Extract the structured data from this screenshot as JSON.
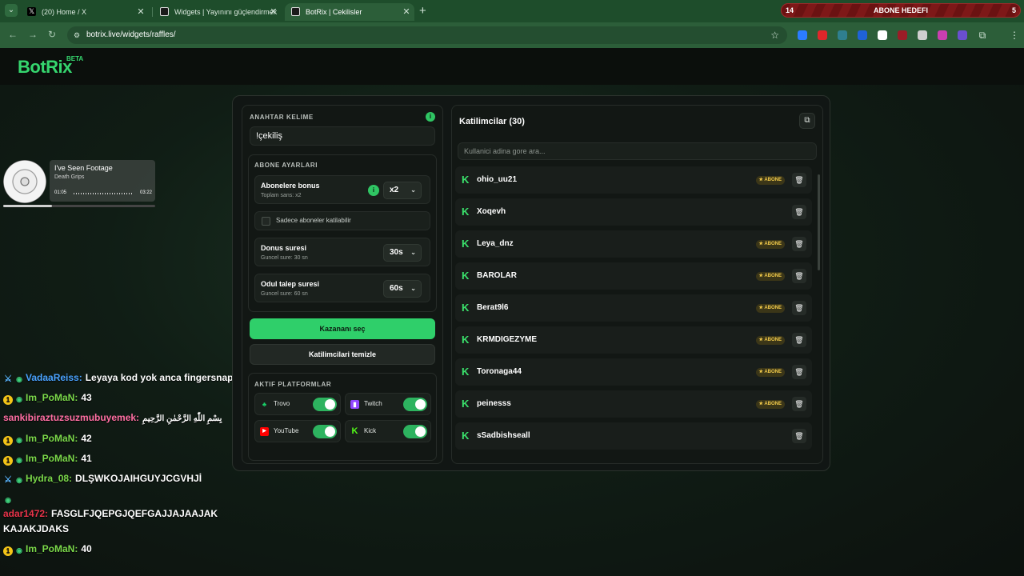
{
  "browser": {
    "tabs": [
      {
        "label": "(20) Home / X",
        "icon": "x-logo-icon"
      },
      {
        "label": "Widgets | Yayınını güçlendirmek",
        "icon": "botrix-favicon-icon"
      },
      {
        "label": "BotRix | Cekilisler",
        "icon": "botrix-favicon-icon"
      }
    ],
    "goal": {
      "left": "14",
      "center": "ABONE HEDEFI",
      "right": "5"
    },
    "url": "botrix.live/widgets/raffles/"
  },
  "header": {
    "logo": "BotRix",
    "beta": "BETA"
  },
  "music": {
    "song": "I've Seen Footage",
    "artist": "Death Grips",
    "start": "01:05",
    "end": "03:22",
    "progress": 0.32
  },
  "chat": [
    {
      "badges": [
        "sword-badge-icon",
        "eye-badge-icon"
      ],
      "user": "VadaaReiss:",
      "color": "#4aa3ff",
      "text": "Leyaya kod yok anca fingersnap"
    },
    {
      "badges": [
        "one-badge-icon",
        "eye-badge-icon"
      ],
      "user": "Im_PoMaN:",
      "color": "#7bd94a",
      "text": "43"
    },
    {
      "badges": [],
      "user": "sankibiraztuzsuzmubuyemek:",
      "color": "#ff6fa3",
      "text": "بِسْمِ اللّٰهِ الرَّحْمٰنِ الرَّحِيمِ"
    },
    {
      "badges": [
        "one-badge-icon",
        "eye-badge-icon"
      ],
      "user": "Im_PoMaN:",
      "color": "#7bd94a",
      "text": "42"
    },
    {
      "badges": [
        "one-badge-icon",
        "eye-badge-icon"
      ],
      "user": "Im_PoMaN:",
      "color": "#7bd94a",
      "text": "41"
    },
    {
      "badges": [
        "sword-badge-icon",
        "eye-badge-icon"
      ],
      "user": "Hydra_08:",
      "color": "#7bd94a",
      "text": "DLŞWKOJAIHGUYJCGVHJİ"
    },
    {
      "badges": [
        "eye-badge-icon"
      ],
      "user": "adar1472:",
      "color": "#e8344a",
      "text": "FASGLFJQEPGJQEFGAJJAJAAJAK KAJAKJDAKS"
    },
    {
      "badges": [
        "one-badge-icon",
        "eye-badge-icon"
      ],
      "user": "Im_PoMaN:",
      "color": "#7bd94a",
      "text": "40"
    }
  ],
  "left_panel": {
    "keyword_label": "ANAHTAR KELIME",
    "keyword_value": "!çekiliş",
    "sub_settings_label": "ABONE AYARLARI",
    "sub_bonus": {
      "title": "Abonelere bonus",
      "sub": "Toplam sans: x2",
      "value": "x2"
    },
    "only_subs_label": "Sadece aboneler katilabilir",
    "bonus_time": {
      "title": "Donus suresi",
      "sub": "Guncel sure: 30 sn",
      "value": "30s"
    },
    "claim_time": {
      "title": "Odul talep suresi",
      "sub": "Guncel sure: 60 sn",
      "value": "60s"
    },
    "pick_winner": "Kazananı seç",
    "clear_participants": "Katilimcilari temizle",
    "platforms_label": "AKTIF PLATFORMLAR",
    "platforms": [
      {
        "name": "Trovo",
        "icon": "trovo-icon",
        "color": "#19d66b",
        "enabled": true
      },
      {
        "name": "Twitch",
        "icon": "twitch-icon",
        "color": "#9146ff",
        "enabled": true
      },
      {
        "name": "YouTube",
        "icon": "youtube-icon",
        "color": "#ff0000",
        "enabled": true
      },
      {
        "name": "Kick",
        "icon": "kick-icon",
        "color": "#53fc18",
        "enabled": true
      }
    ]
  },
  "right_panel": {
    "title": "Katilimcilar (30)",
    "search_placeholder": "Kullanici adina gore ara...",
    "abone_label": "ABONE",
    "participants": [
      {
        "name": "ohio_uu21",
        "abone": true
      },
      {
        "name": "Xoqevh",
        "abone": false
      },
      {
        "name": "Leya_dnz",
        "abone": true
      },
      {
        "name": "BAROLAR",
        "abone": true
      },
      {
        "name": "Berat9l6",
        "abone": true
      },
      {
        "name": "KRMDIGEZYME",
        "abone": true
      },
      {
        "name": "Toronaga44",
        "abone": true
      },
      {
        "name": "peinesss",
        "abone": true
      },
      {
        "name": "sSadbishseall",
        "abone": false
      }
    ]
  },
  "colors": {
    "accent": "#2fcf6a",
    "brand": "#35d66e",
    "abone": "#f0c94a"
  }
}
